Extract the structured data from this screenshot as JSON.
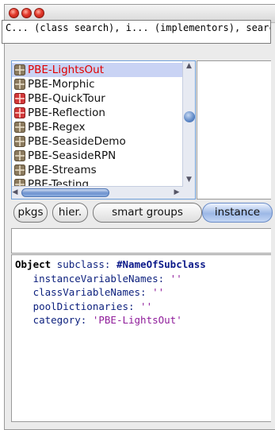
{
  "search": {
    "text": "C... (class search), i... (implementors), search)"
  },
  "packages": [
    {
      "label": "PBE-LightsOut",
      "icon": "package-icon",
      "selected": true
    },
    {
      "label": "PBE-Morphic",
      "icon": "package-icon",
      "selected": false
    },
    {
      "label": "PBE-QuickTour",
      "icon": "package-error-icon",
      "selected": false
    },
    {
      "label": "PBE-Reflection",
      "icon": "package-error-icon",
      "selected": false
    },
    {
      "label": "PBE-Regex",
      "icon": "package-icon",
      "selected": false
    },
    {
      "label": "PBE-SeasideDemo",
      "icon": "package-icon",
      "selected": false
    },
    {
      "label": "PBE-SeasideRPN",
      "icon": "package-icon",
      "selected": false
    },
    {
      "label": "PBE-Streams",
      "icon": "package-icon",
      "selected": false
    },
    {
      "label": "PBE-Testing",
      "icon": "package-icon",
      "selected": false
    }
  ],
  "toolbar": {
    "pkgs": "pkgs",
    "hier": "hier.",
    "smart_groups": "smart groups",
    "instance": "instance"
  },
  "code": {
    "line1_kw": "Object",
    "line1_sel": " subclass: ",
    "line1_sym": "#NameOfSubclass",
    "line2_sel": "   instanceVariableNames: ",
    "line2_str": "''",
    "line3_sel": "   classVariableNames: ",
    "line3_str": "''",
    "line4_sel": "   poolDictionaries: ",
    "line4_str": "''",
    "line5_sel": "   category: ",
    "line5_str": "'PBE-LightsOut'"
  },
  "colors": {
    "selection_bg": "#c9d3f4",
    "selection_text": "#e00000",
    "symbol": "#0c1a8a",
    "string": "#8f1c9a"
  }
}
